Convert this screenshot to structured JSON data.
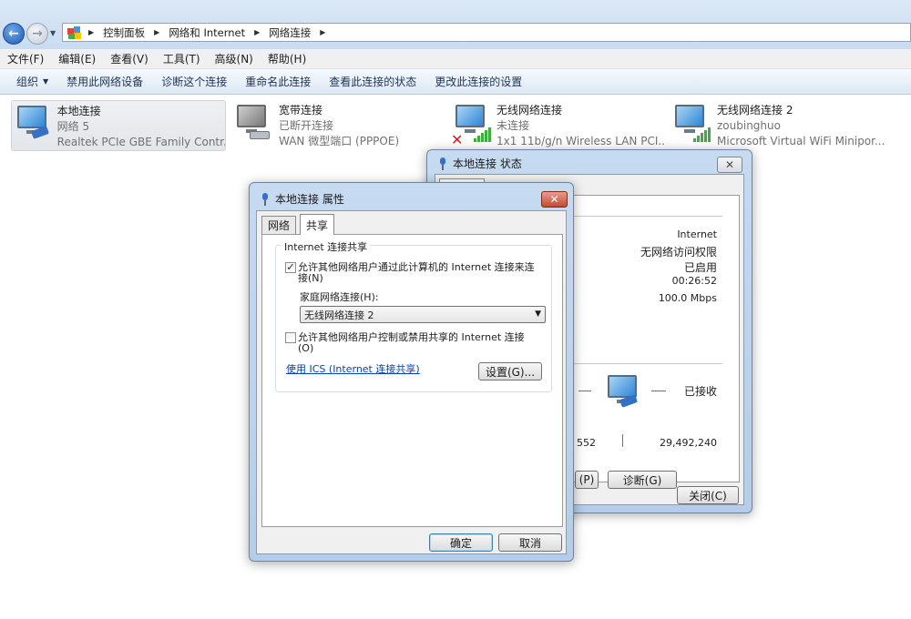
{
  "explorer": {
    "breadcrumbs": [
      "控制面板",
      "网络和 Internet",
      "网络连接"
    ],
    "menu": [
      "文件(F)",
      "编辑(E)",
      "查看(V)",
      "工具(T)",
      "高级(N)",
      "帮助(H)"
    ],
    "commands": [
      "组织",
      "禁用此网络设备",
      "诊断这个连接",
      "重命名此连接",
      "查看此连接的状态",
      "更改此连接的设置"
    ],
    "connections": [
      {
        "name": "本地连接",
        "status": "网络  5",
        "device": "Realtek PCIe GBE Family Contr..."
      },
      {
        "name": "宽带连接",
        "status": "已断开连接",
        "device": "WAN 微型端口 (PPPOE)"
      },
      {
        "name": "无线网络连接",
        "status": "未连接",
        "device": "1x1 11b/g/n Wireless LAN PCI..."
      },
      {
        "name": "无线网络连接 2",
        "status": "zoubinghuo",
        "device": "Microsoft Virtual WiFi Minipor..."
      }
    ]
  },
  "status_window": {
    "title": "本地连接 状态",
    "close_glyph": "✕",
    "values": [
      "Internet",
      "无网络访问权限",
      "已启用",
      "00:26:52",
      "100.0 Mbps"
    ],
    "received_label": "已接收",
    "sent_value_partial": "552",
    "received_value": "29,492,240",
    "properties_button_partial": "(P)",
    "diagnose_button": "诊断(G)",
    "close_button": "关闭(C)"
  },
  "properties_dialog": {
    "title": "本地连接 属性",
    "close_glyph": "✕",
    "tabs": [
      "网络",
      "共享"
    ],
    "group_title": "Internet 连接共享",
    "allow_share_label": "允许其他网络用户通过此计算机的 Internet 连接来连接(N)",
    "allow_share_checked": "✓",
    "home_network_label": "家庭网络连接(H):",
    "home_network_value": "无线网络连接 2",
    "allow_control_label": "允许其他网络用户控制或禁用共享的 Internet 连接(O)",
    "ics_link": "使用 ICS (Internet 连接共享)",
    "settings_button": "设置(G)...",
    "ok_button": "确定",
    "cancel_button": "取消"
  }
}
